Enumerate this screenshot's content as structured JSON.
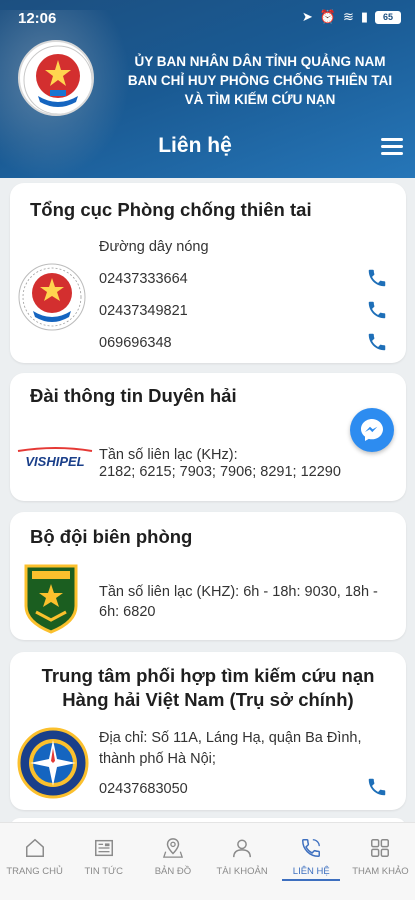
{
  "status_bar": {
    "time": "12:06",
    "battery": "65"
  },
  "header": {
    "line1": "ỦY BAN NHÂN DÂN TỈNH QUẢNG NAM",
    "line2": "BAN CHỈ HUY PHÒNG CHỐNG THIÊN TAI",
    "line3": "VÀ TÌM KIẾM CỨU NẠN",
    "page_title": "Liên hệ"
  },
  "contacts": [
    {
      "title": "Tổng cục Phòng chống thiên tai",
      "label": "Đường dây nóng",
      "phones": [
        "02437333664",
        "02437349821",
        "069696348"
      ]
    },
    {
      "title": "Đài thông tin Duyên hải",
      "logo_text": "VISHIPEL",
      "label": "Tần số liên lạc (KHz):",
      "detail": "2182; 6215; 7903; 7906; 8291; 12290"
    },
    {
      "title": "Bộ đội biên phòng",
      "label": "Tần số liên lạc (KHZ): 6h - 18h: 9030, 18h - 6h: 6820"
    },
    {
      "title_line1": "Trung tâm phối hợp tìm kiếm cứu nạn",
      "title_line2": "Hàng hải Việt Nam (Trụ sở chính)",
      "address_line1": "Địa chỉ: Số 11A, Láng Hạ, quận Ba Đình,",
      "address_line2": "thành phố Hà Nội;",
      "phone": "02437683050"
    }
  ],
  "nav": [
    {
      "label": "TRANG CHỦ",
      "icon": "home-icon"
    },
    {
      "label": "TIN TỨC",
      "icon": "news-icon"
    },
    {
      "label": "BẢN ĐỒ",
      "icon": "map-icon"
    },
    {
      "label": "TÀI KHOẢN",
      "icon": "user-icon"
    },
    {
      "label": "LIÊN HỆ",
      "icon": "phone-icon"
    },
    {
      "label": "THAM KHẢO",
      "icon": "grid-icon"
    }
  ],
  "colors": {
    "primary": "#1a5a93",
    "accent": "#3d6fbf",
    "phone_icon": "#1e6fb8"
  }
}
